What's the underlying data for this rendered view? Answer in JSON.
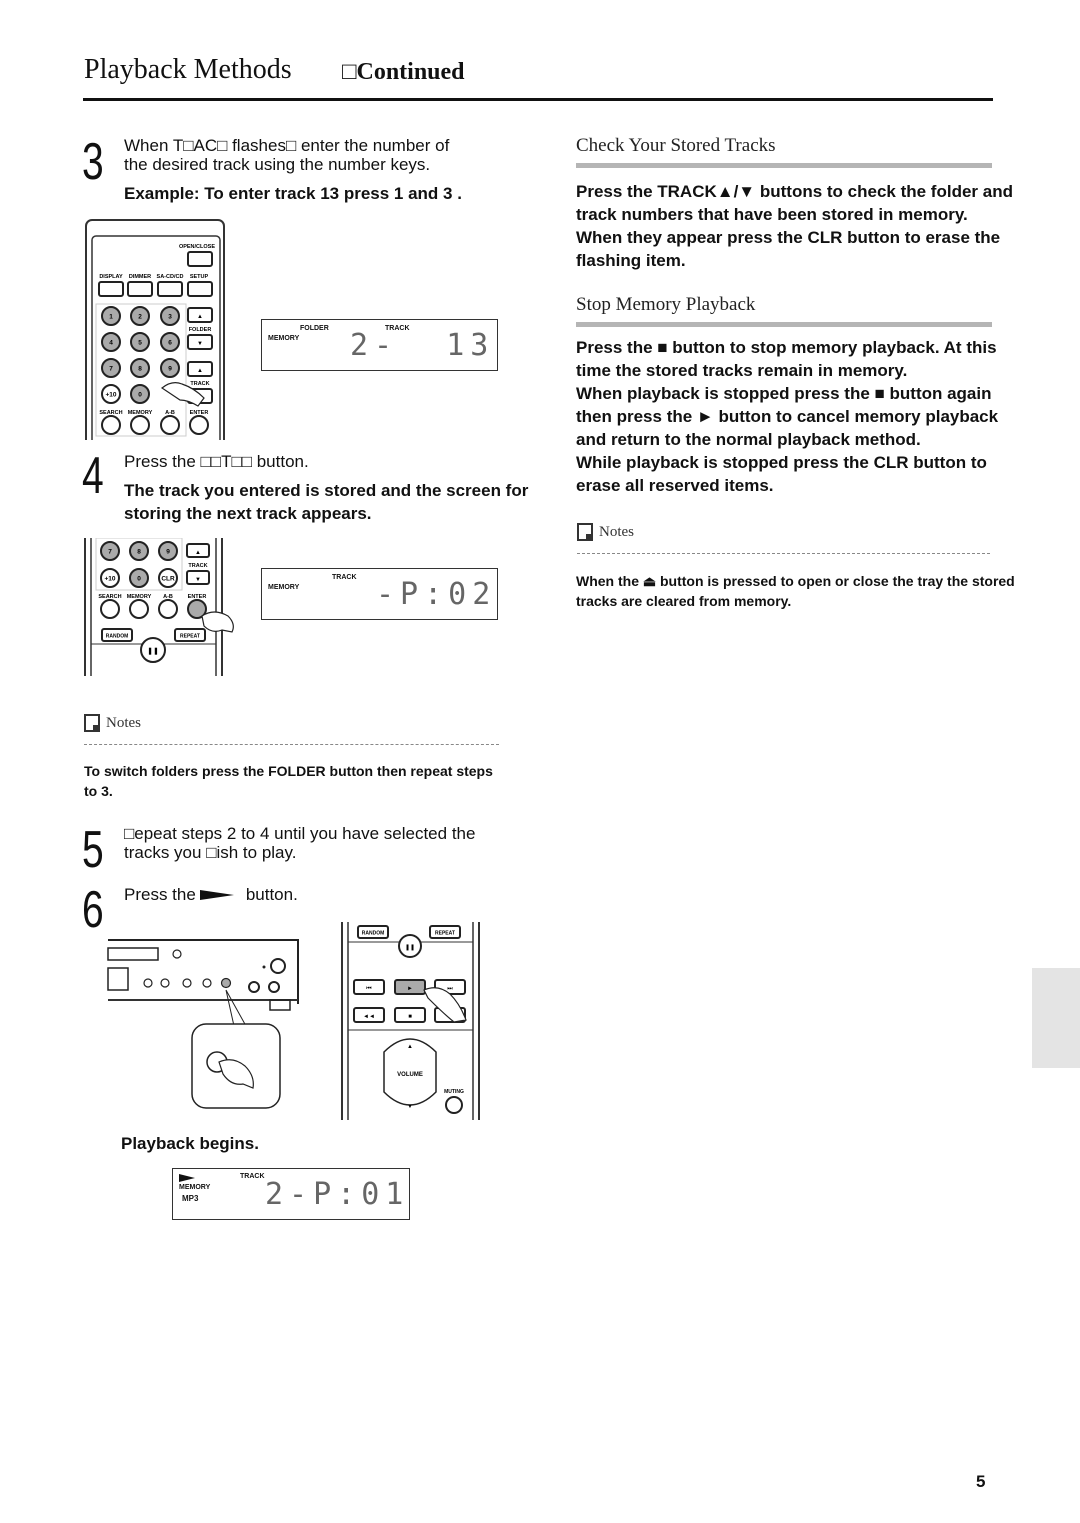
{
  "header": {
    "title": "Playback Methods",
    "continued": "□Continued"
  },
  "left": {
    "step3": {
      "number": "3",
      "line1": "When T□AC□ flashes□ enter the number of",
      "line2": "the desired track using the number keys.",
      "example": "Example: To enter track 13  press  1  and  3 ."
    },
    "remote1": {
      "buttons_top": [
        "OPEN/CLOSE"
      ],
      "labels_row": [
        "DISPLAY",
        "DIMMER",
        "SA-CD/CD",
        "SETUP"
      ],
      "number_keys": [
        "1",
        "2",
        "3",
        "4",
        "5",
        "6",
        "7",
        "8",
        "9",
        "+10",
        "0"
      ],
      "folder_label": "FOLDER",
      "track_label": "TRACK",
      "bottom_labels": [
        "SEARCH",
        "MEMORY",
        "A-B",
        "ENTER"
      ]
    },
    "display1": {
      "folder_label": "FOLDER",
      "track_label": "TRACK",
      "memory_label": "MEMORY",
      "readout": "2-  13"
    },
    "step4": {
      "number": "4",
      "line1": "Press the □□T□□ button.",
      "bold_line1": "The track you entered is stored  and the screen for",
      "bold_line2": "storing the next track appears."
    },
    "remote2": {
      "keys": [
        "7",
        "8",
        "9",
        "+10",
        "0",
        "CLR"
      ],
      "track_label": "TRACK",
      "bottom_labels": [
        "SEARCH",
        "MEMORY",
        "A-B",
        "ENTER"
      ],
      "random": "RANDOM",
      "repeat": "REPEAT"
    },
    "display2": {
      "track_label": "TRACK",
      "memory_label": "MEMORY",
      "readout": "-P:02"
    },
    "notes": {
      "heading": "Notes",
      "line1": "To switch folders  press the FOLDER    button  then repeat steps",
      "line2": "to 3."
    },
    "step5": {
      "number": "5",
      "line1": "□epeat steps 2 to 4 until you have selected the",
      "line2": "tracks you □ish to play."
    },
    "step6": {
      "number": "6",
      "text_before": "Press the",
      "text_after": "button."
    },
    "remote3": {
      "random": "RANDOM",
      "repeat": "REPEAT",
      "volume": "VOLUME",
      "muting": "MUTING"
    },
    "playback_begins": "Playback begins.",
    "display3": {
      "track_label": "TRACK",
      "memory_label": "MEMORY",
      "mp3_label": "MP3",
      "readout": "2-P:01"
    }
  },
  "right": {
    "check": {
      "heading": "Check Your Stored Tracks",
      "lines": [
        "Press the TRACK▲/▼   buttons to check the folder and",
        "track numbers that have been stored in memory.",
        "When they appear  press the CLR button to erase the",
        "flashing item."
      ]
    },
    "stop": {
      "heading": "Stop Memory Playback",
      "lines": [
        "Press the ■    button to stop memory playback. At this",
        "time  the stored tracks remain in memory.",
        "When playback is stopped  press the ■  button again",
        "then press the ►       button to cancel memory playback",
        "and return to the normal playback method.",
        "While playback is stopped  press the CLR button to",
        "erase all reserved items."
      ]
    },
    "notes": {
      "heading": "Notes",
      "line1": "When the ⏏   button is pressed to open or close the tray  the stored",
      "line2": "tracks are cleared from memory."
    }
  },
  "footer": {
    "page_number": "5"
  }
}
